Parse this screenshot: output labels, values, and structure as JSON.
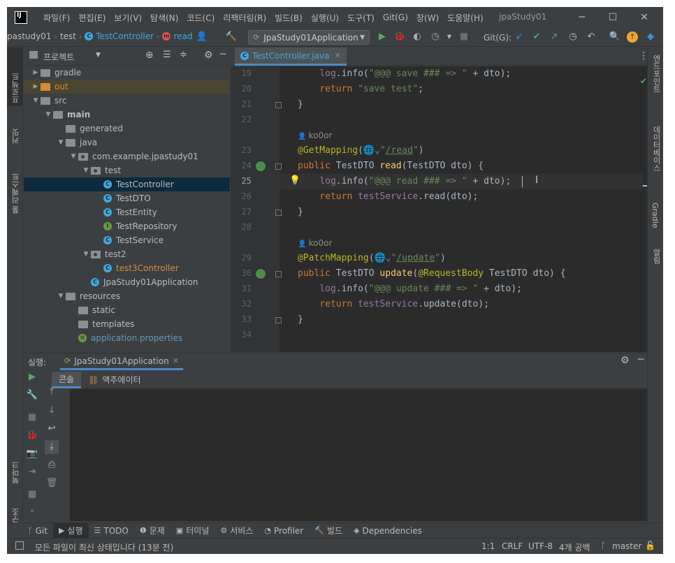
{
  "window": {
    "title": "jpaStudy01",
    "menu": [
      "파일(F)",
      "편집(E)",
      "보기(V)",
      "탐색(N)",
      "코드(C)",
      "리팩터링(R)",
      "빌드(B)",
      "실행(U)",
      "도구(T)",
      "Git(G)",
      "창(W)",
      "도움말(H)"
    ]
  },
  "navbar": {
    "breadcrumbs": [
      "pastudy01",
      "test",
      "TestController",
      "read"
    ],
    "run_config": "JpaStudy01Application",
    "git_label": "Git(G):"
  },
  "left_strip": {
    "items": [
      "프로젝트",
      "커밋",
      "풀 리퀘스트",
      "북마크",
      "구조"
    ]
  },
  "right_strip": {
    "items": [
      "엔드포인트",
      "데이터베이스",
      "Gradle",
      "알림"
    ]
  },
  "project_panel": {
    "title": "프로젝트",
    "tree": [
      {
        "label": "gradle",
        "depth": 1,
        "type": "folder",
        "arrow": "right"
      },
      {
        "label": "out",
        "depth": 1,
        "type": "folder-orange",
        "arrow": "right",
        "state": "excluded"
      },
      {
        "label": "src",
        "depth": 1,
        "type": "folder",
        "arrow": "down"
      },
      {
        "label": "main",
        "depth": 2,
        "type": "folder",
        "arrow": "down",
        "bold": true
      },
      {
        "label": "generated",
        "depth": 3,
        "type": "folder",
        "arrow": ""
      },
      {
        "label": "java",
        "depth": 3,
        "type": "folder",
        "arrow": "down"
      },
      {
        "label": "com.example.jpastudy01",
        "depth": 4,
        "type": "package",
        "arrow": "down"
      },
      {
        "label": "test",
        "depth": 5,
        "type": "package",
        "arrow": "down"
      },
      {
        "label": "TestController",
        "depth": 6,
        "type": "class",
        "arrow": "",
        "selected": true
      },
      {
        "label": "TestDTO",
        "depth": 6,
        "type": "class",
        "arrow": ""
      },
      {
        "label": "TestEntity",
        "depth": 6,
        "type": "class",
        "arrow": ""
      },
      {
        "label": "TestRepository",
        "depth": 6,
        "type": "interface",
        "arrow": ""
      },
      {
        "label": "TestService",
        "depth": 6,
        "type": "class",
        "arrow": ""
      },
      {
        "label": "test2",
        "depth": 5,
        "type": "package",
        "arrow": "down"
      },
      {
        "label": "test3Controller",
        "depth": 6,
        "type": "class-modified",
        "arrow": ""
      },
      {
        "label": "JpaStudy01Application",
        "depth": 5,
        "type": "spring",
        "arrow": ""
      },
      {
        "label": "resources",
        "depth": 3,
        "type": "folder",
        "arrow": "down"
      },
      {
        "label": "static",
        "depth": 4,
        "type": "folder",
        "arrow": ""
      },
      {
        "label": "templates",
        "depth": 4,
        "type": "folder",
        "arrow": ""
      },
      {
        "label": "application.properties",
        "depth": 4,
        "type": "properties",
        "arrow": ""
      }
    ]
  },
  "editor": {
    "tab": "TestController.java",
    "lines": [
      {
        "n": "19",
        "html": "    <span class='log'>log</span>.info(<span class='str'>\"@@@ save ### => \"</span> + dto);"
      },
      {
        "n": "20",
        "html": "    <span class='kw'>return</span> <span class='str'>\"save test\"</span>;"
      },
      {
        "n": "21",
        "html": "}"
      },
      {
        "n": "22",
        "html": ""
      },
      {
        "hint": "ko0or"
      },
      {
        "n": "23",
        "html": "<span class='ann'>@GetMapping</span>(<span style='color:#8c8c8c'>🌐⌄</span><span class='str'>\"<u>/read</u>\"</span>)"
      },
      {
        "n": "24",
        "html": "<span class='kw'>public</span> TestDTO <span class='fn'>read</span>(TestDTO dto) {",
        "gutter": "bean"
      },
      {
        "n": "25",
        "html": "    <span class='log'>log</span>.info(<span class='str'>\"@@@ read ### => \"</span> + dto);",
        "current": true
      },
      {
        "n": "26",
        "html": "    <span class='kw'>return</span> <span class='log'>testService</span>.read(dto);"
      },
      {
        "n": "27",
        "html": "}"
      },
      {
        "n": "28",
        "html": ""
      },
      {
        "hint": "ko0or"
      },
      {
        "n": "29",
        "html": "<span class='ann'>@PatchMapping</span>(<span style='color:#8c8c8c'>🌐⌄</span><span class='str'>\"<u>/update</u>\"</span>)"
      },
      {
        "n": "30",
        "html": "<span class='kw'>public</span> TestDTO <span class='fn'>update</span>(<span class='ann'>@RequestBody</span> TestDTO dto) {",
        "gutter": "bean"
      },
      {
        "n": "31",
        "html": "    <span class='log'>log</span>.info(<span class='str'>\"@@@ update ### => \"</span> + dto);"
      },
      {
        "n": "32",
        "html": "    <span class='kw'>return</span> <span class='log'>testService</span>.update(dto);"
      },
      {
        "n": "33",
        "html": "}"
      },
      {
        "n": "34",
        "html": ""
      }
    ]
  },
  "run_panel": {
    "label": "실행:",
    "config_tab": "JpaStudy01Application",
    "tabs": [
      "콘솔",
      "액추에이터"
    ]
  },
  "bottom_tabs": [
    "Git",
    "실행",
    "TODO",
    "문제",
    "터미널",
    "서비스",
    "Profiler",
    "빌드",
    "Dependencies"
  ],
  "status": {
    "message": "모든 파일이 최신 상태입니다 (13분 전)",
    "position": "1:1",
    "line_sep": "CRLF",
    "encoding": "UTF-8",
    "indent": "4개 공백",
    "branch": "master"
  },
  "colors": {
    "accent": "#4a88c7",
    "class_icon": "#40a8e0",
    "selection": "#0d293e"
  }
}
